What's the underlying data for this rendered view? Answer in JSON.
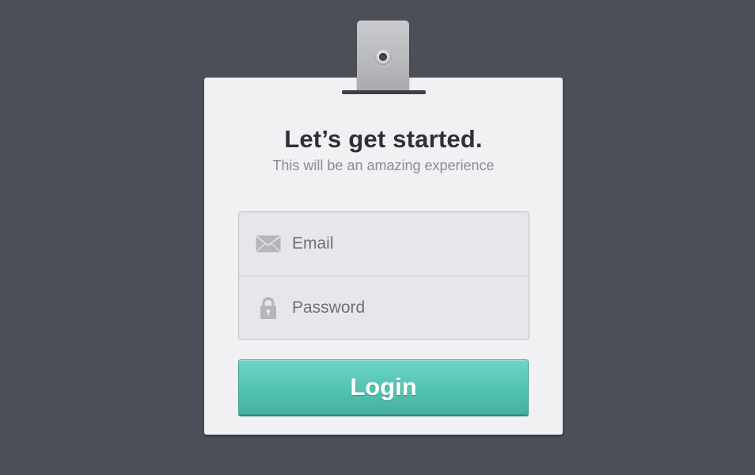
{
  "card": {
    "title": "Let’s get started.",
    "subtitle": "This will be an amazing experience"
  },
  "form": {
    "email": {
      "placeholder": "Email",
      "value": "",
      "icon": "envelope-icon"
    },
    "password": {
      "placeholder": "Password",
      "value": "",
      "icon": "lock-icon"
    }
  },
  "login_button": {
    "label": "Login",
    "color": "#56c4b2"
  },
  "colors": {
    "background": "#4c4f58",
    "card": "#f1f1f4",
    "accent": "#56c4b2"
  }
}
